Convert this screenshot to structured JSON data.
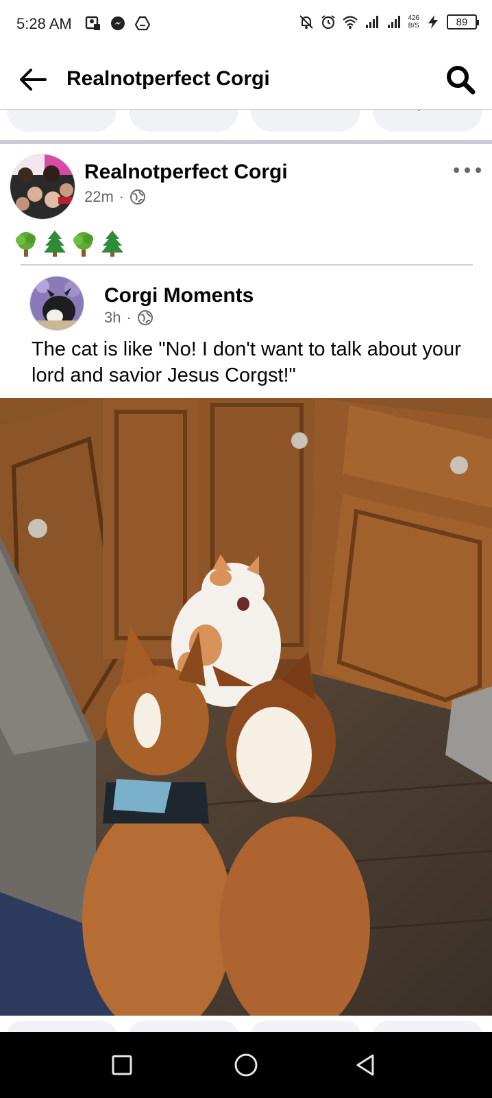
{
  "status_bar": {
    "time": "5:28 AM",
    "net_speed_value": "426",
    "net_speed_unit": "B/S",
    "battery_level": "89",
    "icons": [
      "contact-card-icon",
      "messenger-icon",
      "drive-icon",
      "mute-icon",
      "alarm-icon",
      "wifi-icon",
      "signal-icon",
      "signal-icon",
      "charging-icon"
    ]
  },
  "header": {
    "title": "Realnotperfect Corgi",
    "back_icon": "arrow-left-icon",
    "search_icon": "search-icon"
  },
  "post": {
    "author": "Realnotperfect Corgi",
    "time": "22m",
    "separator": "·",
    "privacy_icon": "globe-icon",
    "more_icon": "more-horizontal-icon",
    "emojis": [
      "🌳",
      "🌲",
      "🌳",
      "🌲"
    ],
    "shared": {
      "author": "Corgi Moments",
      "time": "3h",
      "separator": "·",
      "privacy_icon": "globe-icon",
      "text": "The cat is like \"No! I don't want to talk about your lord and savior Jesus Corgst!\""
    }
  },
  "nav": {
    "icons": [
      "recents-square-icon",
      "home-circle-icon",
      "back-triangle-icon"
    ]
  },
  "colors": {
    "accent_text": "#050505",
    "secondary_text": "#65676b",
    "divider": "#ced0d4",
    "pill_bg": "#f0f2f5"
  }
}
